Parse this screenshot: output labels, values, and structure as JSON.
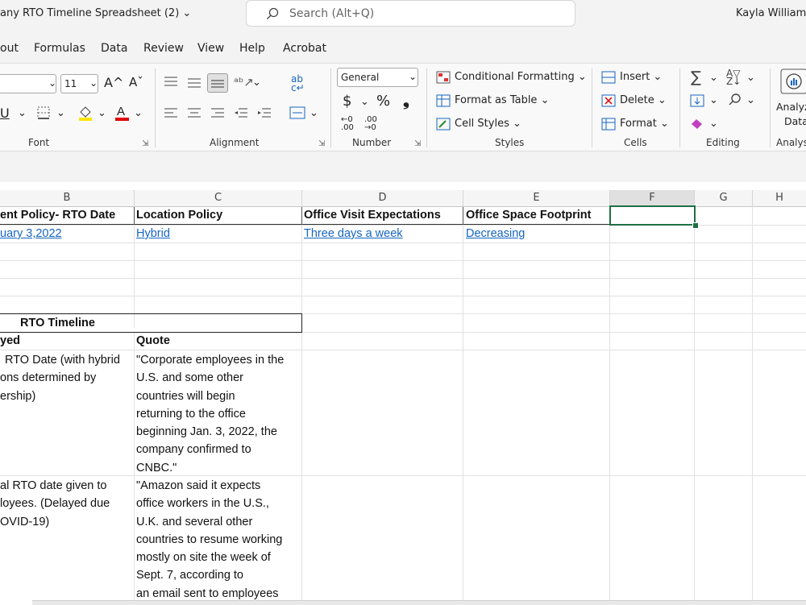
{
  "title_bar": {
    "document_title": "any RTO Timeline Spreadsheet (2)",
    "search_placeholder": "Search (Alt+Q)",
    "user_name": "Kayla Williams"
  },
  "menu_tabs": [
    "out",
    "Formulas",
    "Data",
    "Review",
    "View",
    "Help",
    "Acrobat"
  ],
  "ribbon": {
    "font": {
      "size": "11",
      "label": "Font",
      "grow": "A^",
      "shrink": "Aˇ"
    },
    "alignment": {
      "label": "Alignment"
    },
    "number": {
      "format": "General",
      "currency": "$",
      "percent": "%",
      "comma": "்",
      "label": "Number"
    },
    "styles": {
      "conditional": "Conditional Formatting",
      "table": "Format as Table",
      "cell_styles": "Cell Styles",
      "label": "Styles"
    },
    "cells": {
      "insert": "Insert",
      "delete": "Delete",
      "format": "Format",
      "label": "Cells"
    },
    "editing": {
      "label": "Editing"
    },
    "analysis": {
      "button_line1": "Analyz",
      "button_line2": "Data",
      "label": "Analys"
    }
  },
  "column_headers": [
    "B",
    "C",
    "D",
    "E",
    "F",
    "G",
    "H"
  ],
  "sheet": {
    "row1": {
      "b": "ent Policy- RTO Date",
      "c": "Location Policy",
      "d": "Office Visit Expectations",
      "e": "Office Space Footprint"
    },
    "row2": {
      "b": "uary 3,2022",
      "c": "Hybrid",
      "d": "Three days a week",
      "e": "Decreasing"
    },
    "timeline_title": "RTO Timeline",
    "row_headers": {
      "b": "yed",
      "c": "Quote"
    },
    "entry1": {
      "b": [
        "RTO Date (with hybrid",
        "ons determined by",
        "ership)"
      ],
      "c": [
        "\"Corporate employees in the",
        "U.S. and some other",
        "countries will begin",
        "returning to the office",
        "beginning Jan. 3, 2022, the",
        "company confirmed to",
        "CNBC.\""
      ]
    },
    "entry2": {
      "b": [
        "al RTO date given to",
        "loyees. (Delayed due",
        "OVID-19)"
      ],
      "c": [
        "\"Amazon said it expects",
        "office workers in the U.S.,",
        "U.K. and several other",
        "countries to resume working",
        "mostly on site the week of",
        "Sept. 7, according to",
        "an email sent to employees"
      ]
    }
  },
  "colors": {
    "selection": "#1e7145",
    "link": "#1665c0",
    "accent_red": "#c00000"
  }
}
